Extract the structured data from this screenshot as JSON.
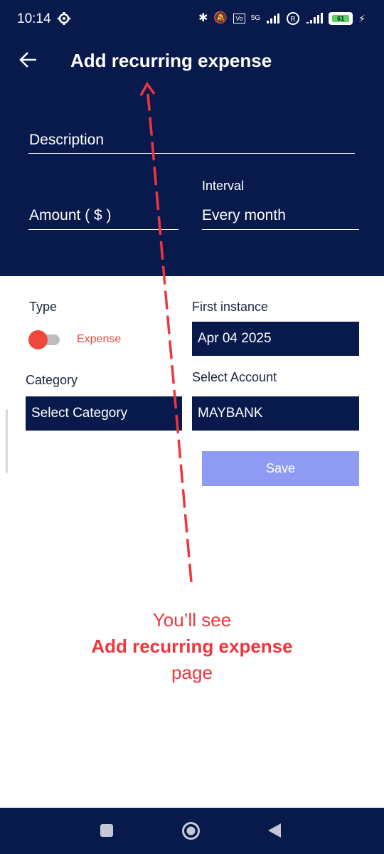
{
  "status_bar": {
    "time": "10:14",
    "network": "5G",
    "battery": "61",
    "icons": [
      "gear-icon",
      "bluetooth-icon",
      "mute-icon",
      "volte-icon",
      "signal-icon",
      "roaming-icon",
      "signal-icon",
      "battery-icon",
      "charging-icon"
    ]
  },
  "header": {
    "title": "Add recurring expense",
    "background": "#081a4b"
  },
  "form": {
    "description_placeholder": "Description",
    "amount_placeholder": "Amount ( $ )",
    "interval_label": "Interval",
    "interval_value": "Every month",
    "type_label": "Type",
    "type_value": "Expense",
    "first_instance_label": "First instance",
    "first_instance_value": "Apr 04 2025",
    "category_label": "Category",
    "category_value": "Select Category",
    "account_label": "Select Account",
    "account_value": "MAYBANK",
    "save_label": "Save"
  },
  "annotation": {
    "line1": "You’ll see",
    "line2": "Add recurring expense",
    "line3": "page",
    "color": "#f0353c"
  },
  "colors": {
    "primary": "#081a4b",
    "accent": "#f0463c",
    "save_button": "#8f9bf2"
  }
}
